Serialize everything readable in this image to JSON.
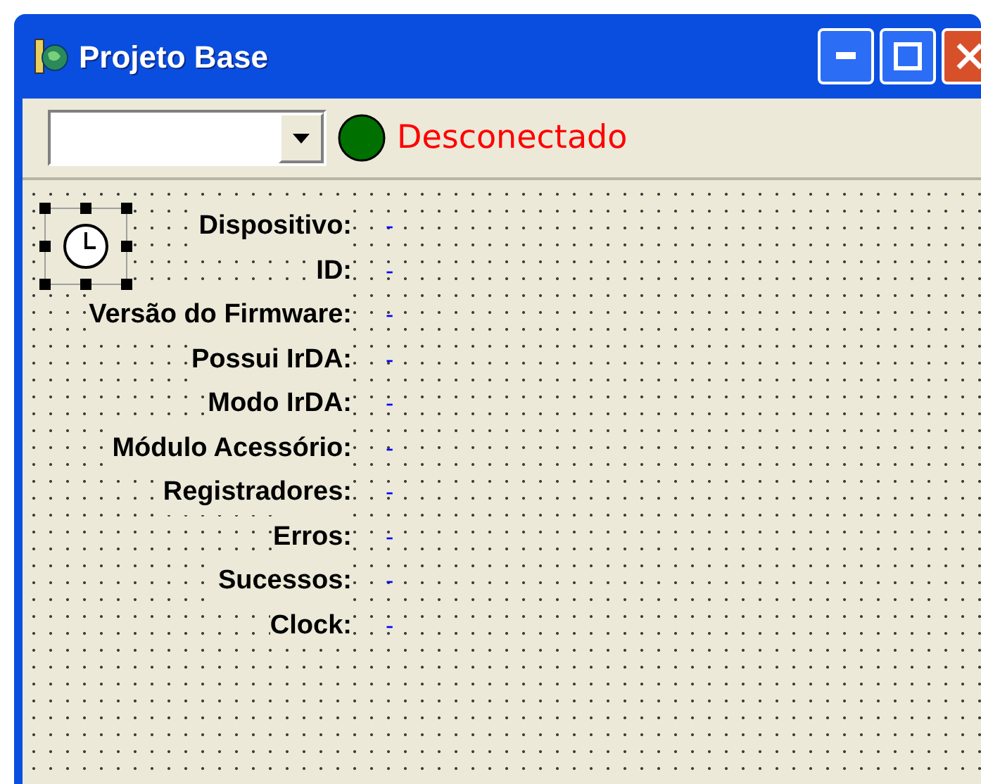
{
  "window": {
    "title": "Projeto Base"
  },
  "toolbar": {
    "status": "Desconectado"
  },
  "fields": [
    {
      "label": "Dispositivo:",
      "value": "-"
    },
    {
      "label": "ID:",
      "value": "-"
    },
    {
      "label": "Versão do Firmware:",
      "value": "-"
    },
    {
      "label": "Possui IrDA:",
      "value": "-"
    },
    {
      "label": "Modo IrDA:",
      "value": "-"
    },
    {
      "label": "Módulo Acessório:",
      "value": "-"
    },
    {
      "label": "Registradores:",
      "value": "-"
    },
    {
      "label": "Erros:",
      "value": "-"
    },
    {
      "label": "Sucessos:",
      "value": "-"
    },
    {
      "label": "Clock:",
      "value": "-"
    }
  ]
}
